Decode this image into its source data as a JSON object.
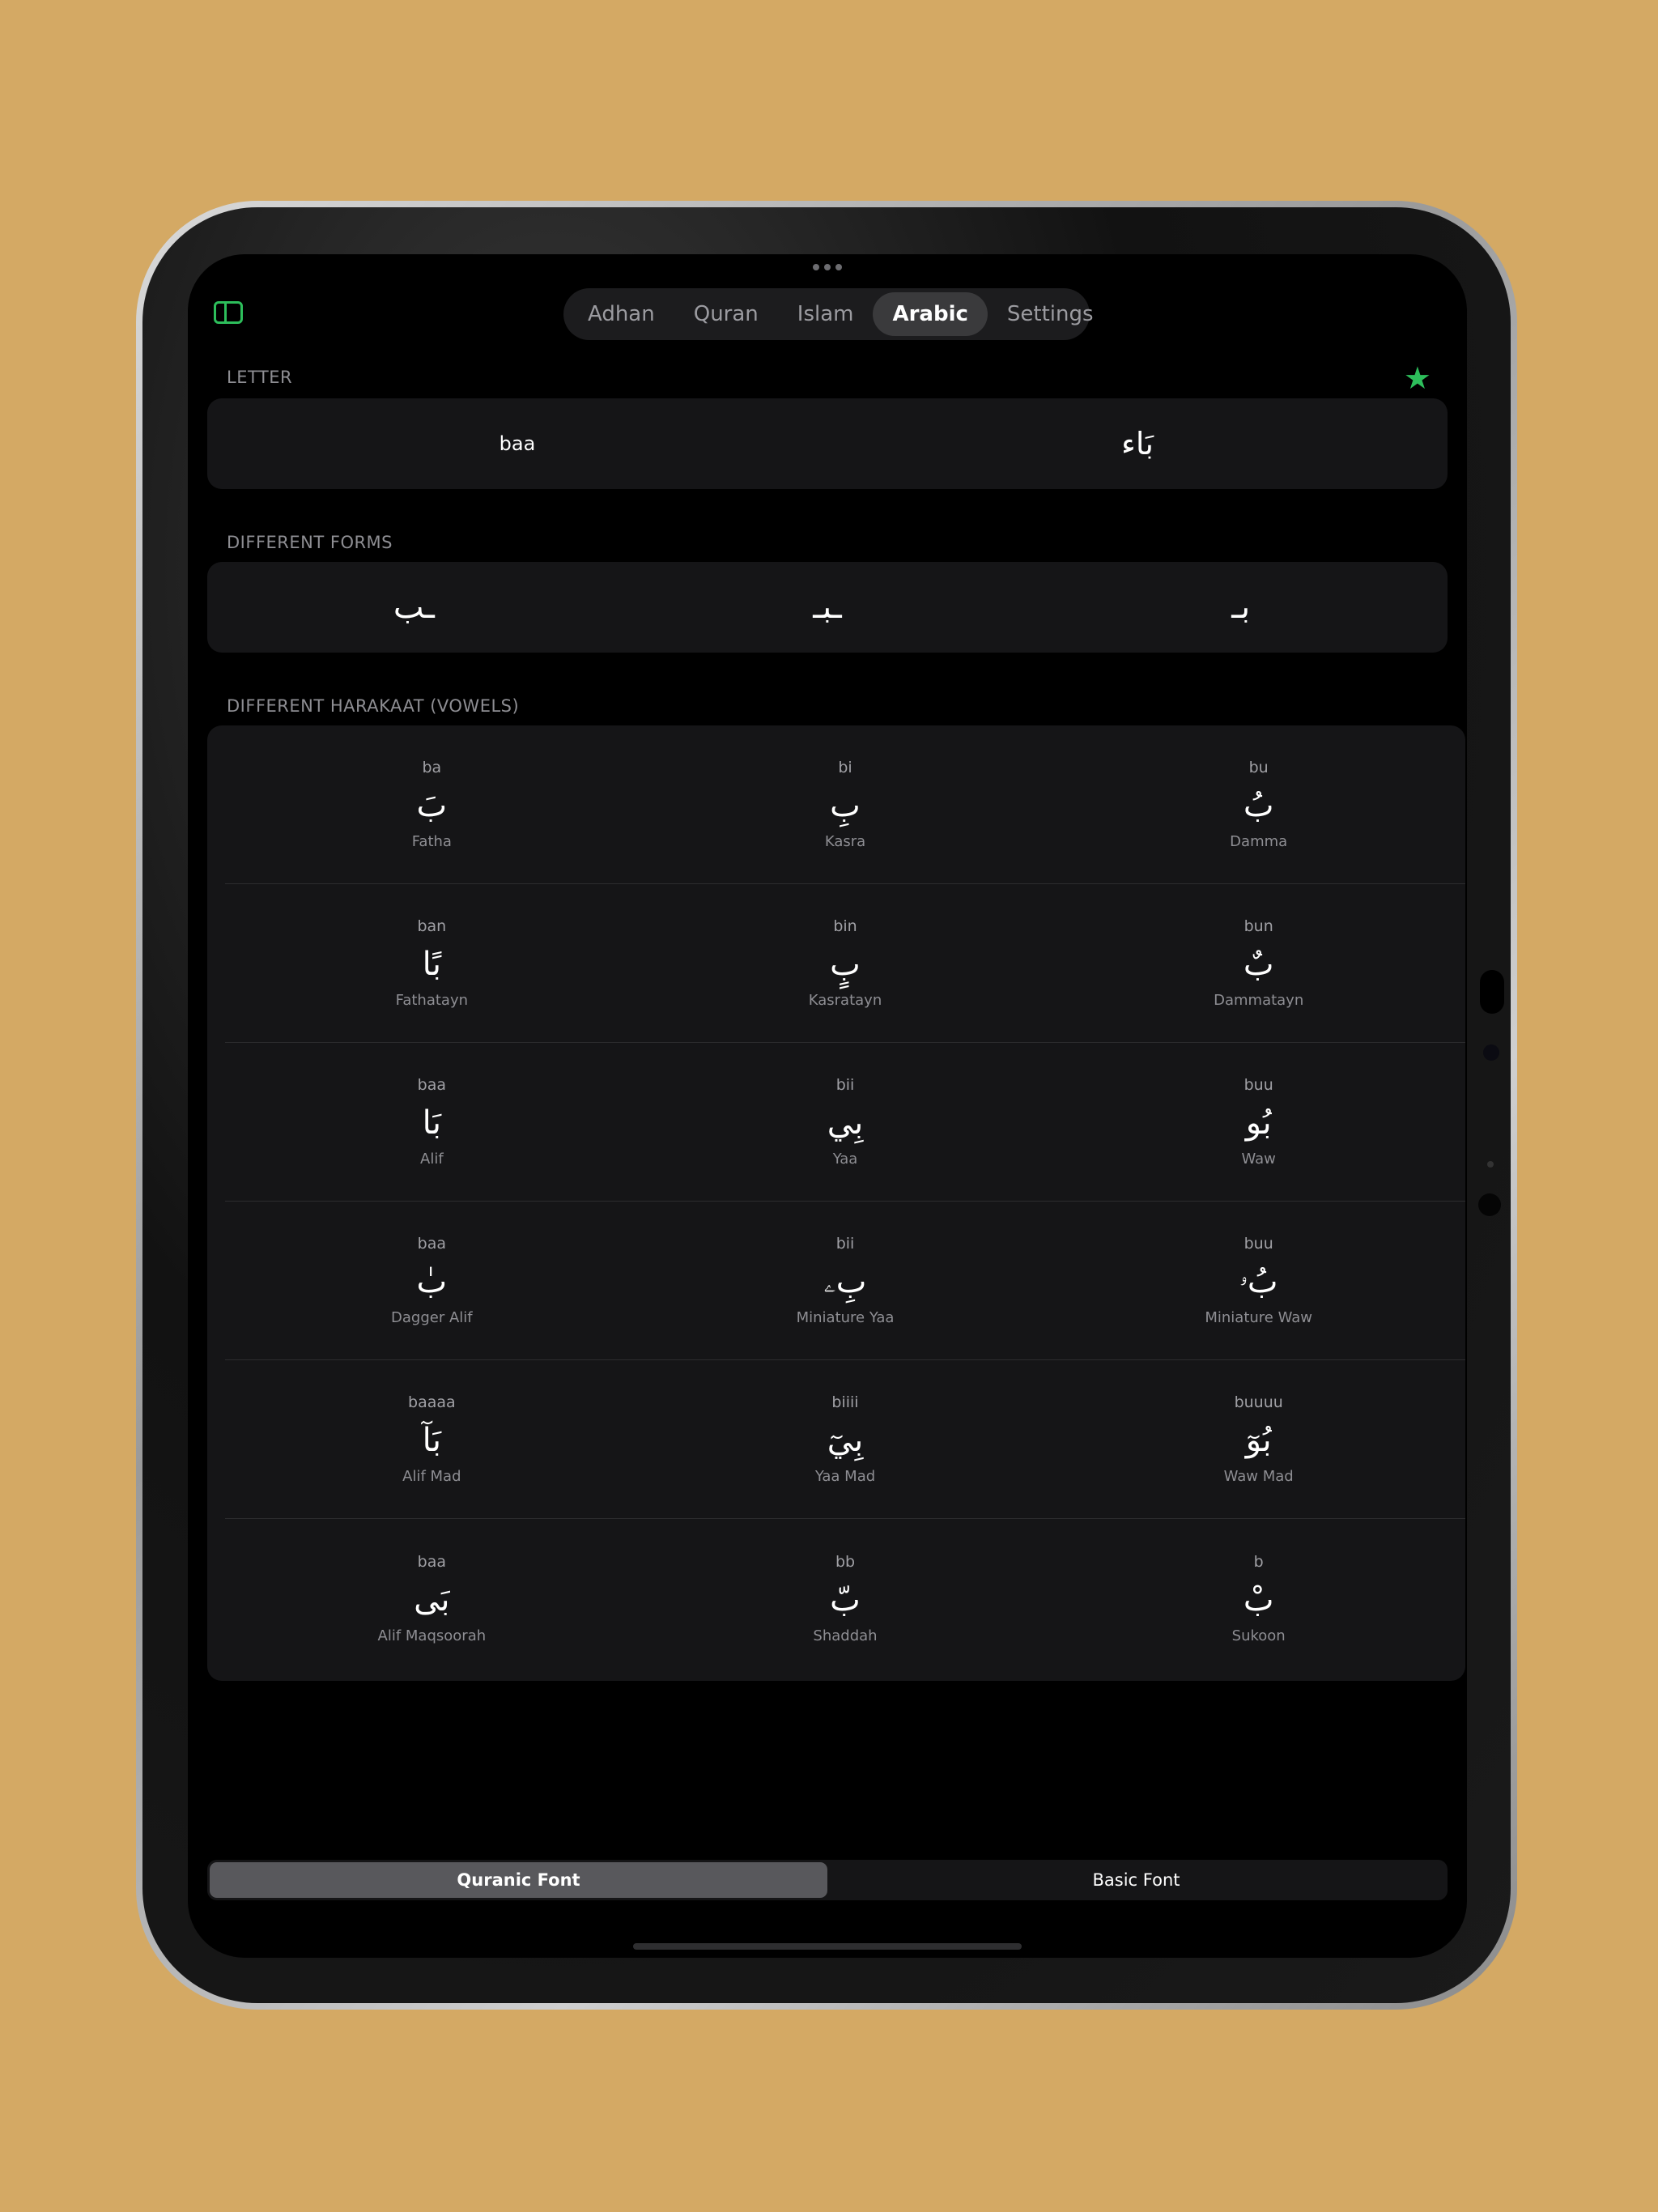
{
  "tabs": [
    {
      "label": "Adhan",
      "active": false
    },
    {
      "label": "Quran",
      "active": false
    },
    {
      "label": "Islam",
      "active": false
    },
    {
      "label": "Arabic",
      "active": true
    },
    {
      "label": "Settings",
      "active": false
    }
  ],
  "letter": {
    "section_label": "LETTER",
    "transliteration": "baa",
    "arabic": "بَاء"
  },
  "forms": {
    "section_label": "DIFFERENT FORMS",
    "items": [
      "ـب",
      "ـبـ",
      "بـ"
    ]
  },
  "harakaat": {
    "section_label": "DIFFERENT HARAKAAT (VOWELS)",
    "rows": [
      [
        {
          "tr": "ba",
          "ar": "بَ",
          "name": "Fatha"
        },
        {
          "tr": "bi",
          "ar": "بِ",
          "name": "Kasra"
        },
        {
          "tr": "bu",
          "ar": "بُ",
          "name": "Damma"
        }
      ],
      [
        {
          "tr": "ban",
          "ar": "بًا",
          "name": "Fathatayn"
        },
        {
          "tr": "bin",
          "ar": "بٍ",
          "name": "Kasratayn"
        },
        {
          "tr": "bun",
          "ar": "بٌ",
          "name": "Dammatayn"
        }
      ],
      [
        {
          "tr": "baa",
          "ar": "بَا",
          "name": "Alif"
        },
        {
          "tr": "bii",
          "ar": "بِي",
          "name": "Yaa"
        },
        {
          "tr": "buu",
          "ar": "بُو",
          "name": "Waw"
        }
      ],
      [
        {
          "tr": "baa",
          "ar": "بٰ",
          "name": "Dagger Alif"
        },
        {
          "tr": "bii",
          "ar": "بِۦ",
          "name": "Miniature Yaa"
        },
        {
          "tr": "buu",
          "ar": "بُۥ",
          "name": "Miniature Waw"
        }
      ],
      [
        {
          "tr": "baaaa",
          "ar": "بَآ",
          "name": "Alif Mad"
        },
        {
          "tr": "biiii",
          "ar": "بِيٓ",
          "name": "Yaa Mad"
        },
        {
          "tr": "buuuu",
          "ar": "بُوٓ",
          "name": "Waw Mad"
        }
      ],
      [
        {
          "tr": "baa",
          "ar": "بَى",
          "name": "Alif Maqsoorah"
        },
        {
          "tr": "bb",
          "ar": "بّ",
          "name": "Shaddah"
        },
        {
          "tr": "b",
          "ar": "بْ",
          "name": "Sukoon"
        }
      ]
    ]
  },
  "font_toggle": {
    "options": [
      {
        "label": "Quranic Font",
        "active": true
      },
      {
        "label": "Basic Font",
        "active": false
      }
    ]
  },
  "icons": {
    "sidebar": "sidebar-toggle-icon",
    "favorite": "star-icon",
    "star_color": "#2DBE5B"
  }
}
